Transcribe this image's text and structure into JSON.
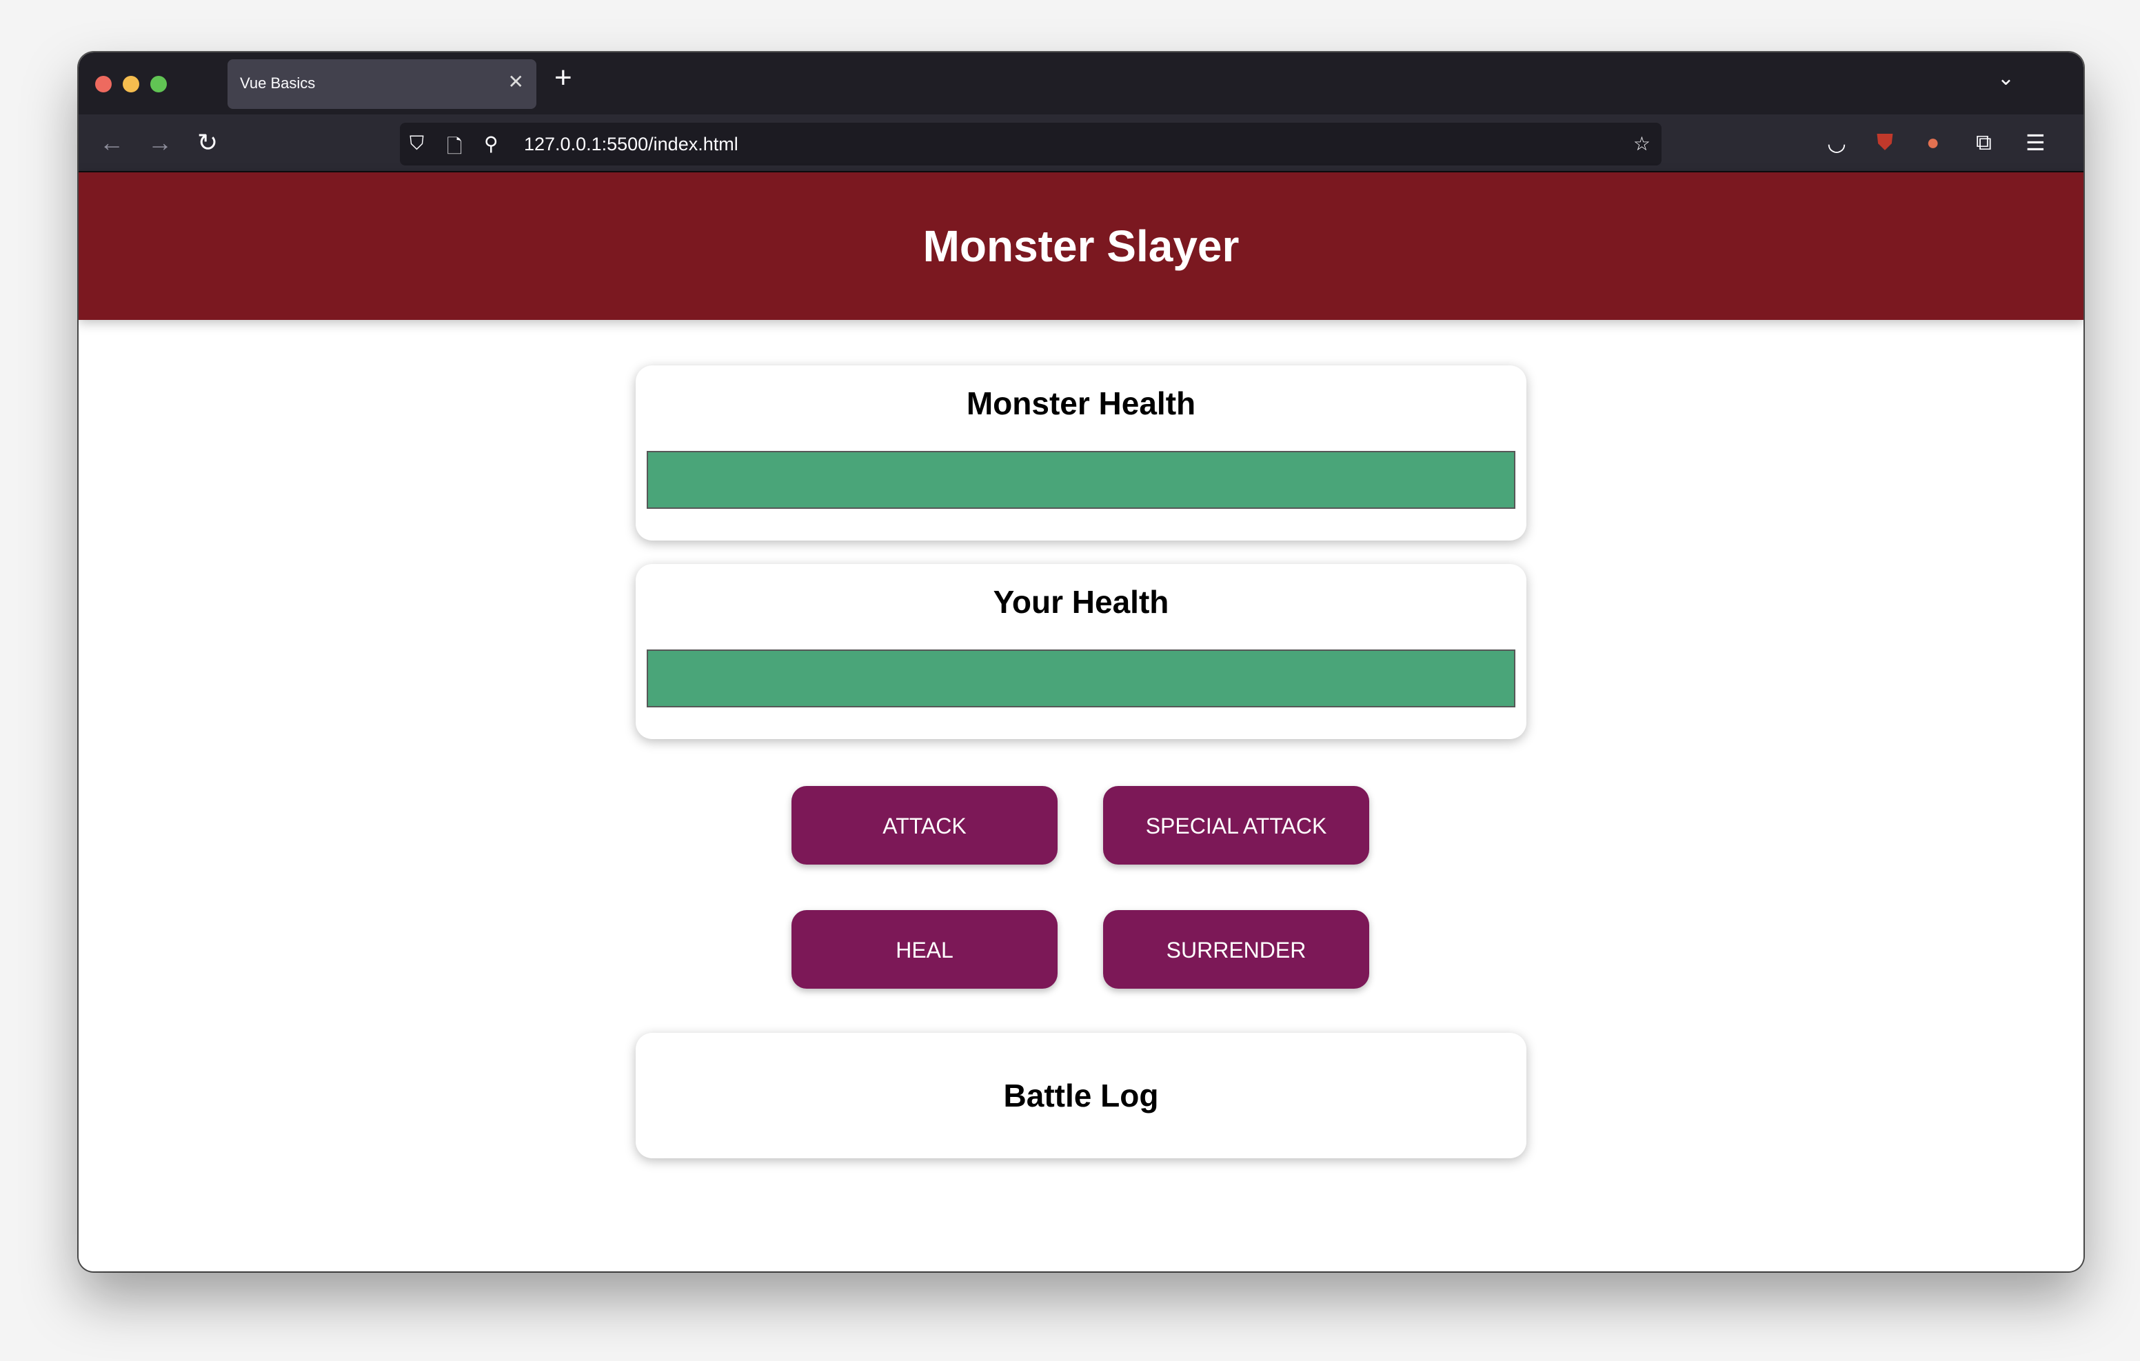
{
  "browser": {
    "tab_title": "Vue Basics",
    "url": "127.0.0.1:5500/index.html",
    "icons": {
      "back": "arrow-left-icon",
      "forward": "arrow-right-icon",
      "reload": "reload-icon",
      "shield": "tracking-protection-icon",
      "page": "page-icon",
      "permissions": "permissions-icon",
      "bookmark": "star-icon",
      "pocket": "pocket-icon",
      "ublock": "ublock-origin-icon",
      "duckduckgo": "duckduckgo-icon",
      "extensions": "extensions-icon",
      "menu": "hamburger-menu-icon"
    }
  },
  "app": {
    "title": "Monster Slayer",
    "monster": {
      "label": "Monster Health",
      "health_percent": 100
    },
    "player": {
      "label": "Your Health",
      "health_percent": 100
    },
    "actions": {
      "attack": "ATTACK",
      "special_attack": "SPECIAL ATTACK",
      "heal": "HEAL",
      "surrender": "SURRENDER"
    },
    "log": {
      "title": "Battle Log",
      "entries": []
    },
    "colors": {
      "header": "#7b1820",
      "button": "#7c1857",
      "health_bar": "#4aa579"
    }
  }
}
